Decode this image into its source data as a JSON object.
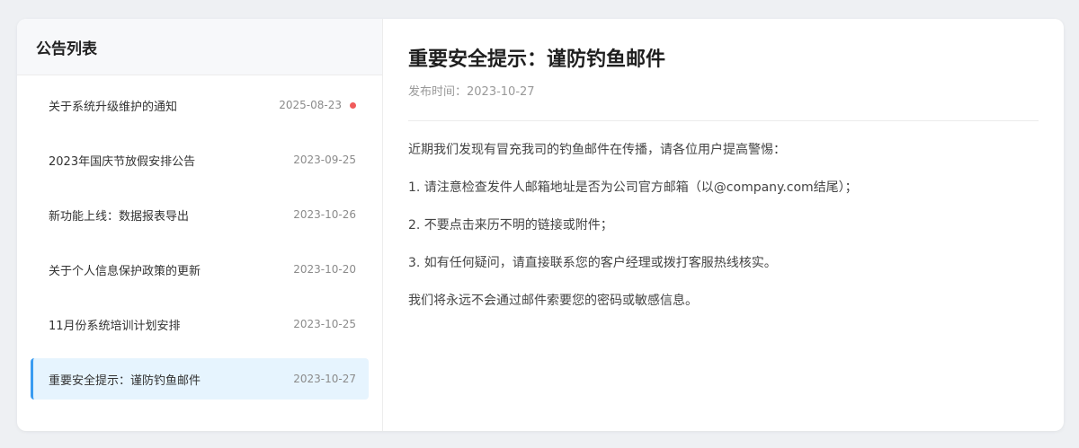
{
  "sidebar": {
    "title": "公告列表",
    "items": [
      {
        "title": "关于系统升级维护的通知",
        "date": "2025-08-23",
        "unread": true
      },
      {
        "title": "2023年国庆节放假安排公告",
        "date": "2023-09-25",
        "unread": false
      },
      {
        "title": "新功能上线：数据报表导出",
        "date": "2023-10-26",
        "unread": false
      },
      {
        "title": "关于个人信息保护政策的更新",
        "date": "2023-10-20",
        "unread": false
      },
      {
        "title": "11月份系统培训计划安排",
        "date": "2023-10-25",
        "unread": false
      },
      {
        "title": "重要安全提示：谨防钓鱼邮件",
        "date": "2023-10-27",
        "unread": false,
        "active": true
      }
    ]
  },
  "detail": {
    "title": "重要安全提示：谨防钓鱼邮件",
    "meta": "发布时间：2023-10-27",
    "paragraphs": [
      "近期我们发现有冒充我司的钓鱼邮件在传播，请各位用户提高警惕：",
      "1. 请注意检查发件人邮箱地址是否为公司官方邮箱（以@company.com结尾）；",
      "2. 不要点击来历不明的链接或附件；",
      "3. 如有任何疑问，请直接联系您的客户经理或拨打客服热线核实。",
      "我们将永远不会通过邮件索要您的密码或敏感信息。"
    ]
  },
  "colors": {
    "accent": "#3a9cf1",
    "active_bg": "#e6f4fe",
    "unread_dot": "#f05b5b"
  }
}
